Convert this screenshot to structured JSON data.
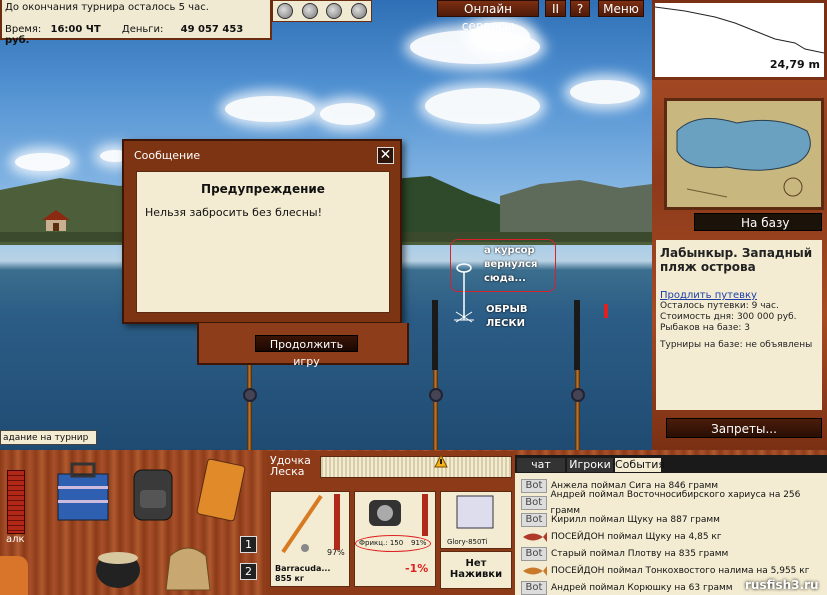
{
  "header": {
    "tournament_notice": "До окончания турнира осталось 5 час.",
    "time_label": "Время:",
    "time_value": "16:00 ЧТ",
    "money_label": "Деньги:",
    "money_value": "49 057 453 руб."
  },
  "top_buttons": {
    "online": "Онлайн сервисы",
    "pause": "II",
    "help": "?",
    "menu": "Меню"
  },
  "depth": {
    "value": "24,79 m"
  },
  "right_panel": {
    "home_button": "На базу",
    "location_title": "Лабынкыр. Западный пляж острова",
    "extend_link": "Продлить путевку",
    "remaining": "Осталось путевки: 9 час.",
    "day_cost": "Стоимость дня: 300 000 руб.",
    "anglers": "Рыбаков на базе: 3",
    "tournaments": "Турниры на базе: не объявлены",
    "rules_button": "Запреты..."
  },
  "dialog": {
    "title": "Сообщение",
    "heading": "Предупреждение",
    "text": "Нельзя забросить без блесны!",
    "continue_button": "Продолжить игру"
  },
  "annotations": {
    "cursor_line1": "а курсор",
    "cursor_line2": "вернулся",
    "cursor_line3": "сюда...",
    "break_line1": "ОБРЫВ",
    "break_line2": "ЛЕСКИ"
  },
  "task_tab": "адание на турнир",
  "bottom": {
    "alc_label": "алк",
    "slots": [
      "1",
      "2"
    ],
    "rod_label": "Удочка",
    "line_label": "Леска",
    "rod_name": "Barracuda...",
    "rod_weight": "855 кг",
    "rod_pct": "97%",
    "reel_info": "Фрикц.: 150",
    "reel_pct": "91%",
    "reel_change": "-1%",
    "lure_name": "Glory-850Ti",
    "bait_line1": "Нет",
    "bait_line2": "Наживки"
  },
  "events": {
    "tabs": [
      "чат",
      "Игроки",
      "События"
    ],
    "rows": [
      {
        "tag": "Bot",
        "text": "Анжела поймал Сига на 846 грамм"
      },
      {
        "tag": "Bot",
        "text": "Андрей поймал Восточносибирского хариуса на 256 грамм"
      },
      {
        "tag": "Bot",
        "text": "Кирилл поймал Щуку на 887 грамм"
      },
      {
        "tag": "fish",
        "text": "ПОСЕЙДОН поймал Щуку на 4,85 кг"
      },
      {
        "tag": "Bot",
        "text": "Старый поймал Плотву на 835 грамм"
      },
      {
        "tag": "fish",
        "text": "ПОСЕЙДОН поймал Тонкохвостого налима на 5,955 кг"
      },
      {
        "tag": "Bot",
        "text": "Андрей поймал Корюшку на 63 грамм"
      }
    ]
  },
  "watermark": "rusfish3.ru"
}
